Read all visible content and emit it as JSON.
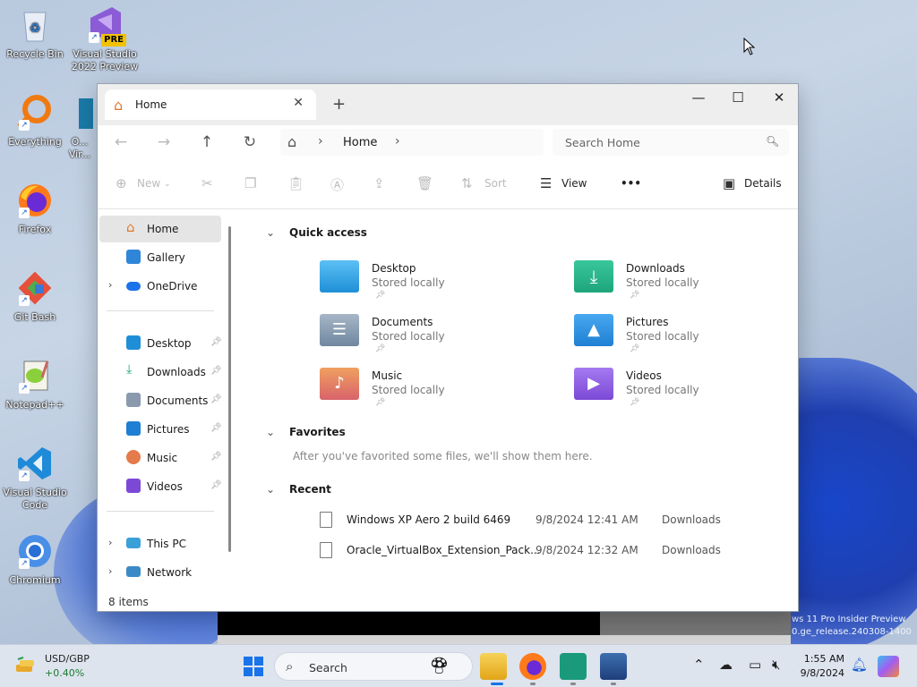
{
  "desktop": {
    "icons": [
      {
        "label": "Recycle Bin"
      },
      {
        "label": "Visual Studio 2022 Preview",
        "badge": "PRE"
      },
      {
        "label": "Everything"
      },
      {
        "label": "O... Vir..."
      },
      {
        "label": "Firefox"
      },
      {
        "label": "Git Bash"
      },
      {
        "label": "Notepad++"
      },
      {
        "label": "Visual Studio Code"
      },
      {
        "label": "Chromium"
      }
    ],
    "vm_text_line1": "ws 11 Pro Insider Preview",
    "vm_text_line2": "0.ge_release.240308-1400"
  },
  "explorer": {
    "tab_title": "Home",
    "new_tab": "+",
    "window_controls": {
      "minimize": "—",
      "maximize": "☐",
      "close": "✕"
    },
    "address": {
      "crumb": "Home"
    },
    "search": {
      "placeholder": "Search Home"
    },
    "commands": {
      "new": "New",
      "sort": "Sort",
      "view": "View",
      "more": "•••",
      "details": "Details"
    },
    "sidebar": {
      "top": [
        {
          "label": "Home"
        },
        {
          "label": "Gallery"
        },
        {
          "label": "OneDrive"
        }
      ],
      "pinned": [
        {
          "label": "Desktop"
        },
        {
          "label": "Downloads"
        },
        {
          "label": "Documents"
        },
        {
          "label": "Pictures"
        },
        {
          "label": "Music"
        },
        {
          "label": "Videos"
        }
      ],
      "bottom": [
        {
          "label": "This PC"
        },
        {
          "label": "Network"
        }
      ]
    },
    "status": "8 items",
    "quick_access": {
      "title": "Quick access",
      "folders": [
        {
          "name": "Desktop",
          "sub": "Stored locally",
          "color": "#1e8fd6"
        },
        {
          "name": "Downloads",
          "sub": "Stored locally",
          "color": "#1ea57a"
        },
        {
          "name": "Documents",
          "sub": "Stored locally",
          "color": "#6f879f"
        },
        {
          "name": "Pictures",
          "sub": "Stored locally",
          "color": "#1f7fd3"
        },
        {
          "name": "Music",
          "sub": "Stored locally",
          "color": "#e57a4a"
        },
        {
          "name": "Videos",
          "sub": "Stored locally",
          "color": "#7c49d6"
        }
      ]
    },
    "favorites": {
      "title": "Favorites",
      "empty_text": "After you've favorited some files, we'll show them here."
    },
    "recent": {
      "title": "Recent",
      "rows": [
        {
          "name": "Windows XP Aero 2 build 6469",
          "date": "9/8/2024 12:41 AM",
          "location": "Downloads"
        },
        {
          "name": "Oracle_VirtualBox_Extension_Pack...",
          "date": "9/8/2024 12:32 AM",
          "location": "Downloads"
        }
      ]
    }
  },
  "taskbar": {
    "widget": {
      "title": "USD/GBP",
      "change": "+0.40%"
    },
    "search_label": "Search",
    "clock": {
      "time": "1:55 AM",
      "date": "9/8/2024"
    }
  }
}
